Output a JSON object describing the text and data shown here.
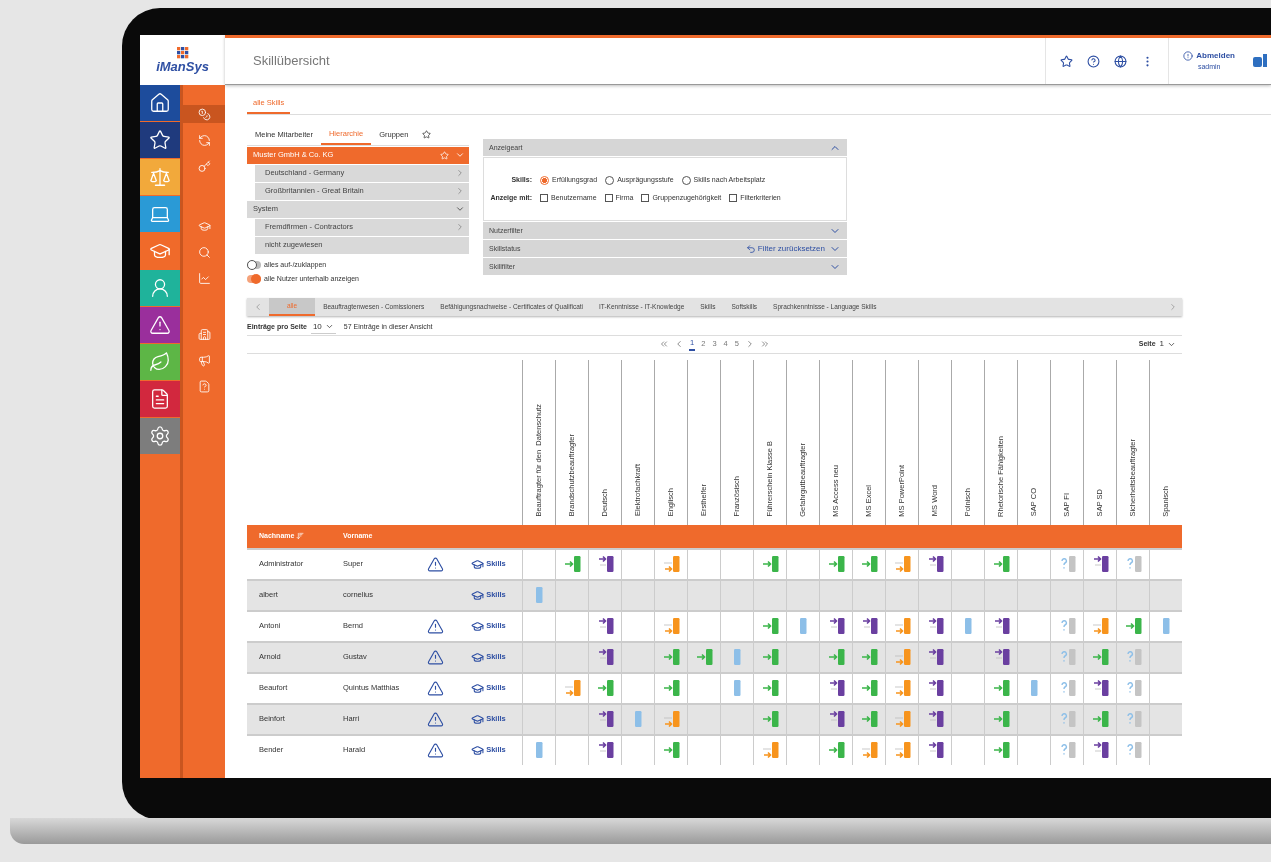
{
  "app": {
    "logo_text": "iManSys"
  },
  "rail": [
    {
      "color": "#1d4c9c"
    },
    {
      "color": "#1f3a7d"
    },
    {
      "color": "#f2a93b"
    },
    {
      "color": "#2a9ad6"
    },
    {
      "color": "#f06a2a"
    },
    {
      "color": "#1fb39b"
    },
    {
      "color": "#9a2f9c"
    },
    {
      "color": "#5db646"
    },
    {
      "color": "#d2283e"
    },
    {
      "color": "#7d7d7d"
    }
  ],
  "subnav": [
    {
      "selected": true
    },
    {
      "selected": false
    },
    {
      "selected": false
    },
    {
      "selected": false
    },
    {
      "selected": false
    },
    {
      "selected": false
    },
    {
      "selected": false
    },
    {
      "selected": false
    },
    {
      "selected": false
    }
  ],
  "header": {
    "title": "Skillübersicht",
    "logout": "Abmelden",
    "user": "sadmin"
  },
  "main_tabs": [
    {
      "label": "alle Skills",
      "selected": true
    }
  ],
  "view_tabs": [
    {
      "label": "Meine Mitarbeiter",
      "selected": false
    },
    {
      "label": "Hierarchie",
      "selected": true
    },
    {
      "label": "Gruppen",
      "selected": false
    }
  ],
  "tree": [
    {
      "label": "Muster GmbH & Co. KG",
      "selected": true,
      "expanded": true,
      "children": [
        {
          "label": "Deutschland - Germany",
          "selected": false,
          "expanded": false
        },
        {
          "label": "Großbritannien - Great Britain",
          "selected": false,
          "expanded": false
        }
      ]
    },
    {
      "label": "System",
      "selected": false,
      "expanded": true,
      "children": [
        {
          "label": "Fremdfirmen - Contractors",
          "selected": false,
          "expanded": false
        },
        {
          "label": "nicht zugewiesen",
          "selected": false
        }
      ]
    }
  ],
  "toggles": [
    {
      "label": "alles auf-/zuklappen",
      "on": false
    },
    {
      "label": "alle Nutzer unterhalb anzeigen",
      "on": true
    }
  ],
  "display_panel": {
    "title": "Anzeigeart",
    "expanded": true,
    "skills_label": "Skills:",
    "radios": [
      {
        "label": "Erfüllungsgrad",
        "selected": true
      },
      {
        "label": "Ausprägungsstufe",
        "selected": false
      },
      {
        "label": "Skills nach Arbeitsplatz",
        "selected": false
      }
    ],
    "show_label": "Anzeige mit:",
    "checkboxes": [
      {
        "label": "Benutzername",
        "checked": false
      },
      {
        "label": "Firma",
        "checked": false
      },
      {
        "label": "Gruppenzugehörigkeit",
        "checked": false
      },
      {
        "label": "Filterkriterien",
        "checked": false
      }
    ]
  },
  "filter_sections": [
    {
      "title": "Nutzerfilter",
      "expanded": false
    },
    {
      "title": "Skillstatus",
      "expanded": false,
      "action": "Filter zurücksetzen"
    },
    {
      "title": "Skillfilter",
      "expanded": false
    }
  ],
  "category_tabs": [
    {
      "label": "alle",
      "selected": true
    },
    {
      "label": "Beauftragtenwesen - Comissioners",
      "selected": false
    },
    {
      "label": "Befähigungsnachweise - Certificates of Qualificati",
      "selected": false
    },
    {
      "label": "IT-Kenntnisse - IT-Knowledge",
      "selected": false
    },
    {
      "label": "Skills",
      "selected": false
    },
    {
      "label": "Softskills",
      "selected": false
    },
    {
      "label": "Sprachkenntnisse - Language Skills",
      "selected": false
    }
  ],
  "paging": {
    "per_page_label": "Einträge pro Seite",
    "per_page": "10",
    "summary": "57 Einträge in dieser Ansicht",
    "pages": [
      {
        "label": "1",
        "selected": true
      },
      {
        "label": "2",
        "selected": false
      },
      {
        "label": "3",
        "selected": false
      },
      {
        "label": "4",
        "selected": false
      },
      {
        "label": "5",
        "selected": false
      }
    ],
    "page_label": "Seite",
    "page": "1"
  },
  "table": {
    "columns": [
      "Nachname",
      "Vorname"
    ],
    "skill_columns": [
      "Beauftragter für den  Datenschutz",
      "Brandschutzbeauftragter",
      "Deutsch",
      "Elektrofachkraft",
      "Englisch",
      "Ersthelfer",
      "Französisch",
      "Führerschein Klasse B",
      "Gefahrgutbeauftragter",
      "MS Access neu",
      "MS Excel",
      "MS PowerPoint",
      "MS Word",
      "Polnisch",
      "Rhetorische Fähigkeiten",
      "SAP CO",
      "SAP FI",
      "SAP SD",
      "Sicherheitsbeauftragter",
      "Spanisch"
    ],
    "rows": [
      {
        "last": "Administrator",
        "first": "Super",
        "warning": true,
        "link": "Skills",
        "skills": [
          {
            "kind": "none"
          },
          {
            "kind": "met"
          },
          {
            "kind": "above"
          },
          {
            "kind": "none"
          },
          {
            "kind": "below"
          },
          {
            "kind": "none"
          },
          {
            "kind": "none"
          },
          {
            "kind": "met"
          },
          {
            "kind": "none"
          },
          {
            "kind": "met"
          },
          {
            "kind": "met"
          },
          {
            "kind": "below"
          },
          {
            "kind": "above"
          },
          {
            "kind": "none"
          },
          {
            "kind": "met"
          },
          {
            "kind": "none"
          },
          {
            "kind": "unknown"
          },
          {
            "kind": "above"
          },
          {
            "kind": "unknown"
          },
          {
            "kind": "none"
          }
        ]
      },
      {
        "last": "albert",
        "first": "cornelius",
        "warning": false,
        "link": "Skills",
        "skills": [
          {
            "kind": "plain"
          },
          {
            "kind": "none"
          },
          {
            "kind": "none"
          },
          {
            "kind": "none"
          },
          {
            "kind": "none"
          },
          {
            "kind": "none"
          },
          {
            "kind": "none"
          },
          {
            "kind": "none"
          },
          {
            "kind": "none"
          },
          {
            "kind": "none"
          },
          {
            "kind": "none"
          },
          {
            "kind": "none"
          },
          {
            "kind": "none"
          },
          {
            "kind": "none"
          },
          {
            "kind": "none"
          },
          {
            "kind": "none"
          },
          {
            "kind": "none"
          },
          {
            "kind": "none"
          },
          {
            "kind": "none"
          },
          {
            "kind": "none"
          }
        ]
      },
      {
        "last": "Antoni",
        "first": "Bernd",
        "warning": true,
        "link": "Skills",
        "skills": [
          {
            "kind": "none"
          },
          {
            "kind": "none"
          },
          {
            "kind": "above"
          },
          {
            "kind": "none"
          },
          {
            "kind": "below"
          },
          {
            "kind": "none"
          },
          {
            "kind": "none"
          },
          {
            "kind": "met"
          },
          {
            "kind": "plain"
          },
          {
            "kind": "above"
          },
          {
            "kind": "above"
          },
          {
            "kind": "below"
          },
          {
            "kind": "above"
          },
          {
            "kind": "plain"
          },
          {
            "kind": "above"
          },
          {
            "kind": "none"
          },
          {
            "kind": "unknown"
          },
          {
            "kind": "below"
          },
          {
            "kind": "met"
          },
          {
            "kind": "plain"
          }
        ]
      },
      {
        "last": "Arnold",
        "first": "Gustav",
        "warning": true,
        "link": "Skills",
        "skills": [
          {
            "kind": "none"
          },
          {
            "kind": "none"
          },
          {
            "kind": "above"
          },
          {
            "kind": "none"
          },
          {
            "kind": "met"
          },
          {
            "kind": "met"
          },
          {
            "kind": "plain"
          },
          {
            "kind": "met"
          },
          {
            "kind": "none"
          },
          {
            "kind": "met"
          },
          {
            "kind": "met"
          },
          {
            "kind": "below"
          },
          {
            "kind": "above"
          },
          {
            "kind": "none"
          },
          {
            "kind": "above"
          },
          {
            "kind": "none"
          },
          {
            "kind": "unknown"
          },
          {
            "kind": "met"
          },
          {
            "kind": "unknown"
          },
          {
            "kind": "none"
          }
        ]
      },
      {
        "last": "Beaufort",
        "first": "Quintus Matthias",
        "warning": true,
        "link": "Skills",
        "skills": [
          {
            "kind": "none"
          },
          {
            "kind": "below"
          },
          {
            "kind": "met"
          },
          {
            "kind": "none"
          },
          {
            "kind": "met"
          },
          {
            "kind": "none"
          },
          {
            "kind": "plain"
          },
          {
            "kind": "met"
          },
          {
            "kind": "none"
          },
          {
            "kind": "above"
          },
          {
            "kind": "met"
          },
          {
            "kind": "below"
          },
          {
            "kind": "above"
          },
          {
            "kind": "none"
          },
          {
            "kind": "met"
          },
          {
            "kind": "plain"
          },
          {
            "kind": "unknown"
          },
          {
            "kind": "above"
          },
          {
            "kind": "unknown"
          },
          {
            "kind": "none"
          }
        ]
      },
      {
        "last": "Beinfort",
        "first": "Harri",
        "warning": true,
        "link": "Skills",
        "skills": [
          {
            "kind": "none"
          },
          {
            "kind": "none"
          },
          {
            "kind": "above"
          },
          {
            "kind": "plain"
          },
          {
            "kind": "below"
          },
          {
            "kind": "none"
          },
          {
            "kind": "none"
          },
          {
            "kind": "met"
          },
          {
            "kind": "none"
          },
          {
            "kind": "above"
          },
          {
            "kind": "met"
          },
          {
            "kind": "below"
          },
          {
            "kind": "above"
          },
          {
            "kind": "none"
          },
          {
            "kind": "met"
          },
          {
            "kind": "none"
          },
          {
            "kind": "unknown"
          },
          {
            "kind": "met"
          },
          {
            "kind": "unknown"
          },
          {
            "kind": "none"
          }
        ]
      },
      {
        "last": "Bender",
        "first": "Harald",
        "warning": true,
        "link": "Skills",
        "skills": [
          {
            "kind": "plain"
          },
          {
            "kind": "none"
          },
          {
            "kind": "above"
          },
          {
            "kind": "none"
          },
          {
            "kind": "met"
          },
          {
            "kind": "none"
          },
          {
            "kind": "none"
          },
          {
            "kind": "below"
          },
          {
            "kind": "none"
          },
          {
            "kind": "met"
          },
          {
            "kind": "below"
          },
          {
            "kind": "below"
          },
          {
            "kind": "above"
          },
          {
            "kind": "none"
          },
          {
            "kind": "met"
          },
          {
            "kind": "none"
          },
          {
            "kind": "unknown"
          },
          {
            "kind": "above"
          },
          {
            "kind": "unknown"
          },
          {
            "kind": "none"
          }
        ]
      }
    ]
  }
}
